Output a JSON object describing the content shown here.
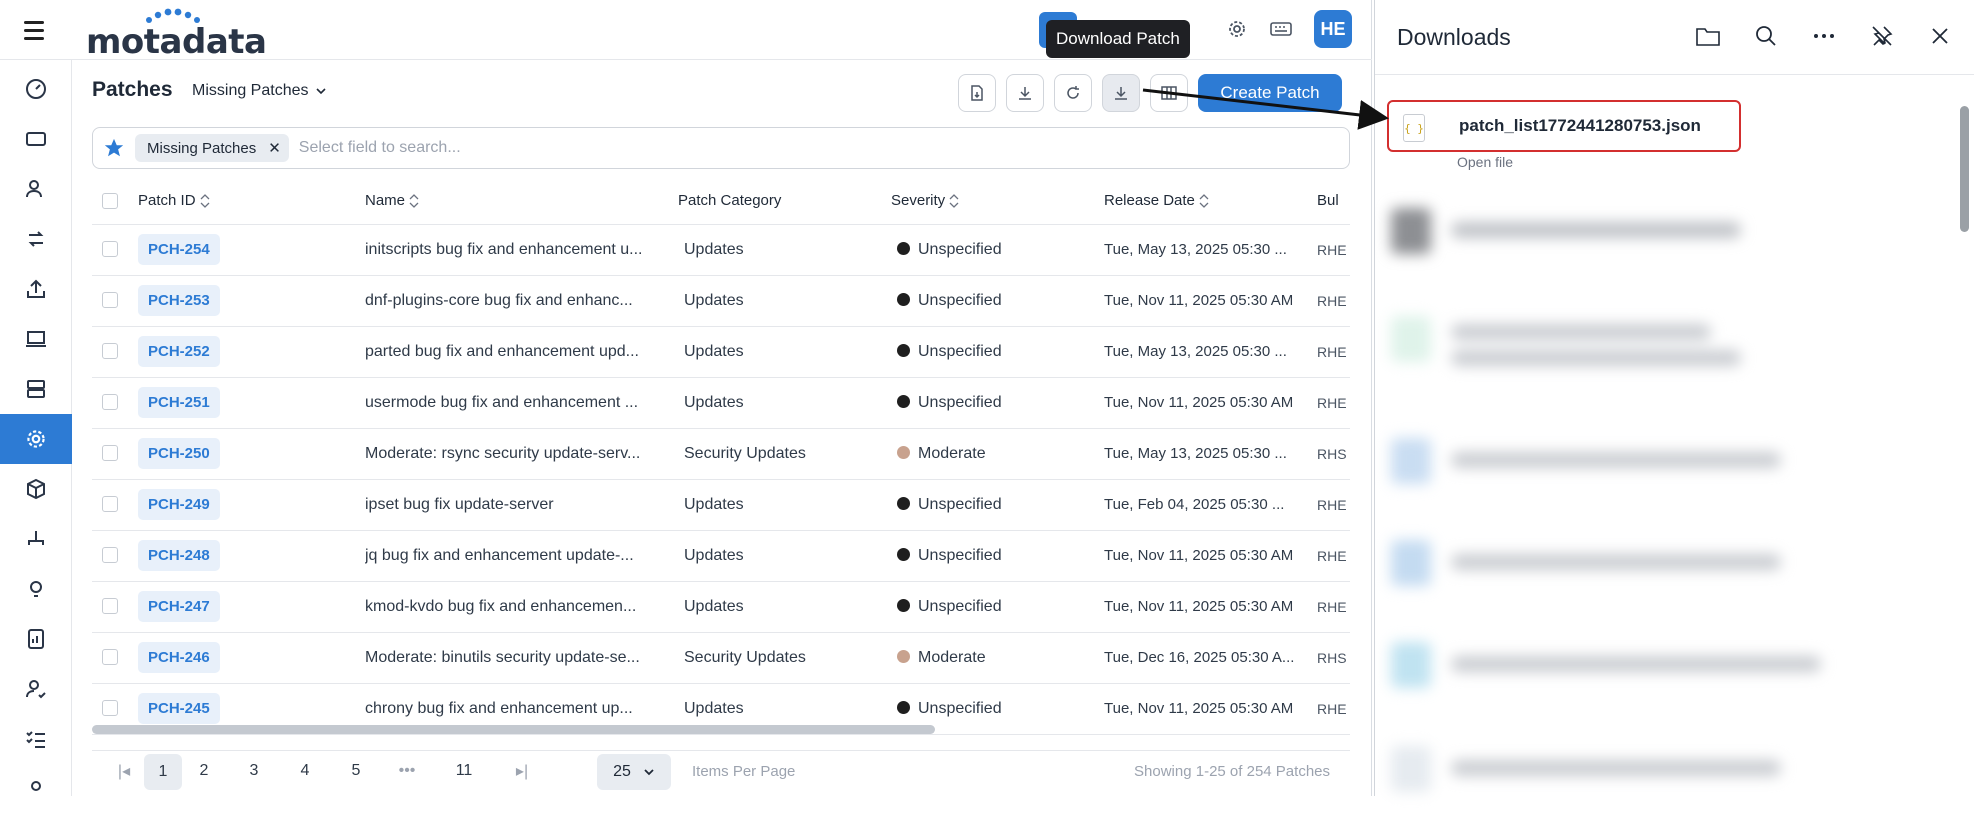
{
  "header": {
    "brand": "motadata",
    "avatar_initials": "HE",
    "tooltip": "Download Patch"
  },
  "page": {
    "title": "Patches",
    "view": "Missing Patches"
  },
  "toolbar": {
    "create_label": "Create Patch"
  },
  "search": {
    "chip": "Missing Patches",
    "placeholder": "Select field to search..."
  },
  "table": {
    "columns": [
      "Patch ID",
      "Name",
      "Patch Category",
      "Severity",
      "Release Date",
      "Bul"
    ],
    "rows": [
      {
        "id": "PCH-254",
        "name": "initscripts bug fix and enhancement u...",
        "category": "Updates",
        "severity": "Unspecified",
        "date": "Tue, May 13, 2025 05:30 ...",
        "bul": "RHE"
      },
      {
        "id": "PCH-253",
        "name": "dnf-plugins-core bug fix and enhanc...",
        "category": "Updates",
        "severity": "Unspecified",
        "date": "Tue, Nov 11, 2025 05:30 AM",
        "bul": "RHE"
      },
      {
        "id": "PCH-252",
        "name": "parted bug fix and enhancement upd...",
        "category": "Updates",
        "severity": "Unspecified",
        "date": "Tue, May 13, 2025 05:30 ...",
        "bul": "RHE"
      },
      {
        "id": "PCH-251",
        "name": "usermode bug fix and enhancement ...",
        "category": "Updates",
        "severity": "Unspecified",
        "date": "Tue, Nov 11, 2025 05:30 AM",
        "bul": "RHE"
      },
      {
        "id": "PCH-250",
        "name": "Moderate: rsync security update-serv...",
        "category": "Security Updates",
        "severity": "Moderate",
        "date": "Tue, May 13, 2025 05:30 ...",
        "bul": "RHS"
      },
      {
        "id": "PCH-249",
        "name": "ipset bug fix update-server",
        "category": "Updates",
        "severity": "Unspecified",
        "date": "Tue, Feb 04, 2025 05:30 ...",
        "bul": "RHE"
      },
      {
        "id": "PCH-248",
        "name": "jq bug fix and enhancement update-...",
        "category": "Updates",
        "severity": "Unspecified",
        "date": "Tue, Nov 11, 2025 05:30 AM",
        "bul": "RHE"
      },
      {
        "id": "PCH-247",
        "name": "kmod-kvdo bug fix and enhancemen...",
        "category": "Updates",
        "severity": "Unspecified",
        "date": "Tue, Nov 11, 2025 05:30 AM",
        "bul": "RHE"
      },
      {
        "id": "PCH-246",
        "name": "Moderate: binutils security update-se...",
        "category": "Security Updates",
        "severity": "Moderate",
        "date": "Tue, Dec 16, 2025 05:30 A...",
        "bul": "RHS"
      },
      {
        "id": "PCH-245",
        "name": "chrony bug fix and enhancement up...",
        "category": "Updates",
        "severity": "Unspecified",
        "date": "Tue, Nov 11, 2025 05:30 AM",
        "bul": "RHE"
      }
    ]
  },
  "severity_colors": {
    "Unspecified": "#1f1f1f",
    "Moderate": "#c8a28e"
  },
  "pager": {
    "pages": [
      "1",
      "2",
      "3",
      "4",
      "5",
      "•••",
      "11"
    ],
    "per_page": "25",
    "per_page_label": "Items Per Page",
    "showing": "Showing 1-25 of 254 Patches"
  },
  "downloads": {
    "title": "Downloads",
    "file_name": "patch_list1772441280753.json",
    "open_label": "Open file"
  },
  "colors": {
    "accent": "#2d7bd4",
    "highlight": "#d32f2f"
  }
}
